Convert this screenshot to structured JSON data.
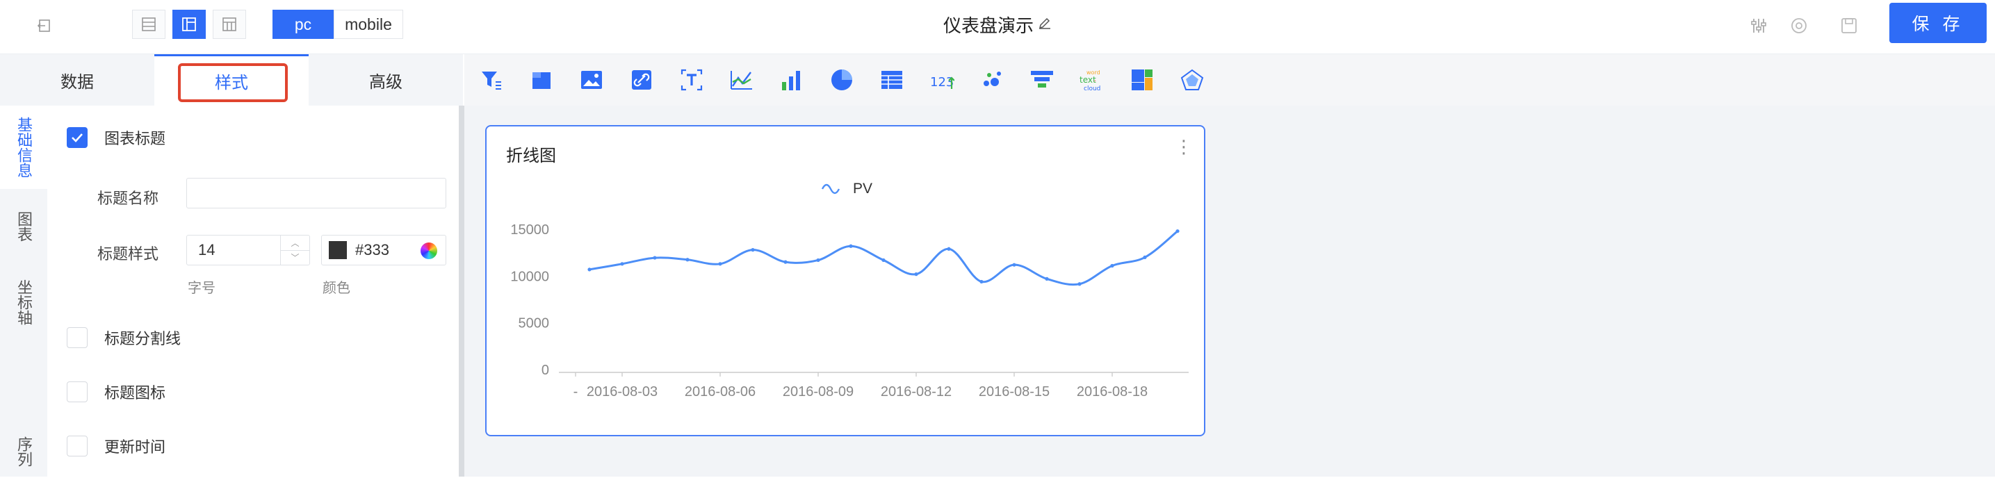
{
  "app": {
    "title": "仪表盘演示",
    "save_label": "保 存",
    "pc_label": "pc",
    "mobile_label": "mobile"
  },
  "colors": {
    "accent": "#2f6cf6",
    "highlight": "#e0442f",
    "line": "#4c8ef7"
  },
  "left_panel": {
    "tabs": [
      {
        "label": "数据"
      },
      {
        "label": "样式"
      },
      {
        "label": "高级"
      }
    ],
    "vnav": [
      {
        "label": "基础信息"
      },
      {
        "label": "图表"
      },
      {
        "label": "坐标轴"
      },
      {
        "label": "序列"
      }
    ],
    "chart_title_label": "图表标题",
    "title_name_label": "标题名称",
    "title_name_value": "",
    "title_style_label": "标题样式",
    "font_size_value": "14",
    "font_size_caption": "字号",
    "color_value": "#333",
    "color_caption": "颜色",
    "divider_label": "标题分割线",
    "icon_label": "标题图标",
    "update_time_label": "更新时间"
  },
  "chart_toolbar_icons": [
    "filter-icon",
    "table-block-icon",
    "image-icon",
    "link-icon",
    "text-icon",
    "line-chart-icon",
    "bar-chart-icon",
    "pie-chart-icon",
    "table-icon",
    "number-icon",
    "scatter-icon",
    "funnel-icon",
    "word-cloud-icon",
    "treemap-icon",
    "radar-icon"
  ],
  "card": {
    "title": "折线图",
    "more_icon": "⋮"
  },
  "chart_data": {
    "type": "line",
    "title": "",
    "smooth": true,
    "legend": "top-center",
    "series": [
      {
        "name": "PV",
        "values": [
          10700,
          11300,
          11950,
          11750,
          11300,
          12800,
          11500,
          11700,
          13200,
          11700,
          10200,
          12900,
          9400,
          11200,
          9700,
          9150,
          11100,
          12000,
          14800
        ]
      }
    ],
    "x_tick_labels": [
      "-",
      "2016-08-03",
      "2016-08-06",
      "2016-08-09",
      "2016-08-12",
      "2016-08-15",
      "2016-08-18"
    ],
    "y_ticks": [
      0,
      5000,
      10000,
      15000
    ],
    "ylim": [
      0,
      15000
    ]
  }
}
